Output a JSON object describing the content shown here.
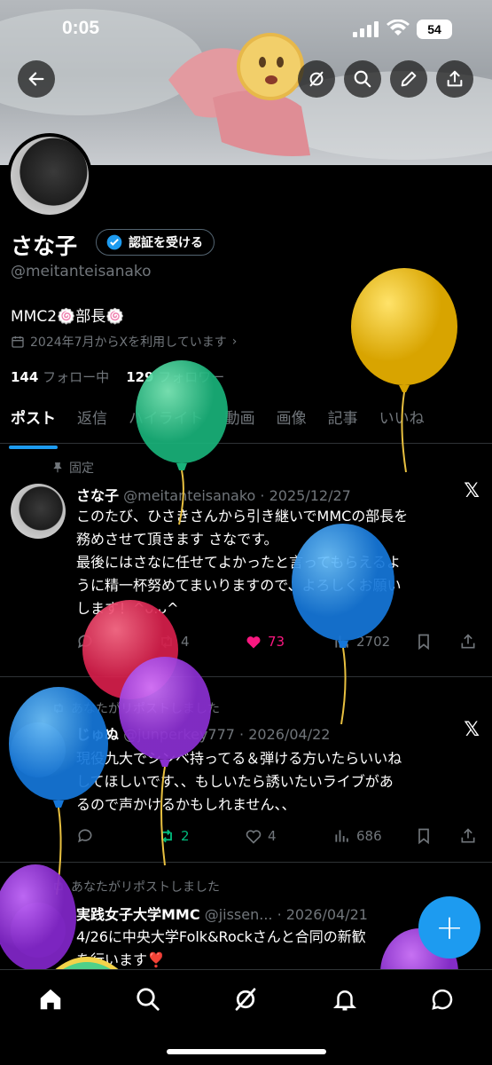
{
  "status": {
    "time": "0:05",
    "battery": "54"
  },
  "profile": {
    "name": "さな子",
    "verify_label": "認証を受ける",
    "handle": "@meitanteisanako",
    "bio": "MMC2🍥部長🍥",
    "joined": "2024年7月からXを利用しています",
    "following_count": "144",
    "following_label": "フォロー中",
    "followers_count": "129",
    "followers_label": "フォロワー"
  },
  "tabs": [
    "ポスト",
    "返信",
    "ハイライト",
    "動画",
    "画像",
    "記事",
    "いいね"
  ],
  "posts": [
    {
      "meta": "固定",
      "name": "さな子",
      "handle_time": "@meitanteisanako · 2025/12/27",
      "lines": [
        "このたび、ひさきさんから引き継いでMMCの部長を",
        "務めさせて頂きます さなです。",
        "最後にはさなに任せてよかったと言ってもらえるよ",
        "うに精一杯努めてまいりますので、よろしくお願い",
        "します！^ᴗ.ᴗ^"
      ],
      "reposts": "4",
      "likes": "73",
      "views": "2702"
    },
    {
      "meta": "あなたがリポストしました",
      "name": "じゅぬ",
      "handle_time": "@junperkey777 · 2026/04/22",
      "lines": [
        "現役九大でシンベ持ってる＆弾ける方いたらいいね",
        "してほしいです、、もしいたら誘いたいライブがあ",
        "るので声かけるかもしれません、、"
      ],
      "reposts": "2",
      "likes": "4",
      "views": "686"
    },
    {
      "meta": "あなたがリポストしました",
      "name": "実践女子大学MMC",
      "handle_time": "@jissen... · 2026/04/21",
      "lines": [
        "4/26に中央大学Folk&Rockさんと合同の新歓",
        "を行います❣️"
      ]
    }
  ],
  "fab_label": "+",
  "colors": {
    "accent": "#1d9bf0",
    "like": "#f91880",
    "repost": "#00ba7c"
  }
}
